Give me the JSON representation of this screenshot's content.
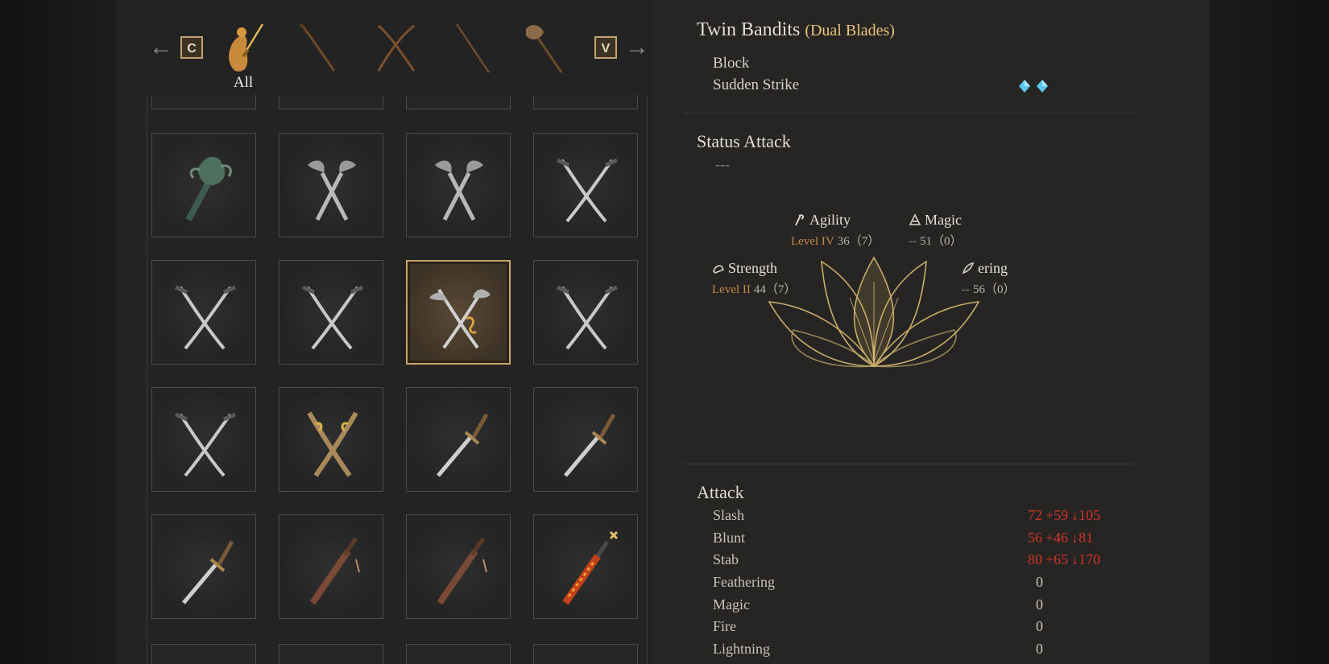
{
  "category_bar": {
    "prev_key": "C",
    "next_key": "V",
    "categories": [
      {
        "icon": "all-weapons-icon",
        "label": "All"
      },
      {
        "icon": "curved-sword-icon"
      },
      {
        "icon": "dual-blades-icon"
      },
      {
        "icon": "spear-icon"
      },
      {
        "icon": "axe-icon"
      }
    ]
  },
  "weapon_grid": {
    "items": [
      {
        "icon": "clawed-club-icon"
      },
      {
        "icon": "hook-dual-blades-icon"
      },
      {
        "icon": "hook-dual-blades-icon"
      },
      {
        "icon": "crossed-sabers-icon"
      },
      {
        "icon": "crossed-sabers-icon"
      },
      {
        "icon": "crossed-sabers-icon"
      },
      {
        "icon": "twin-bandits-icon",
        "selected": true
      },
      {
        "icon": "crossed-sabers-icon"
      },
      {
        "icon": "crossed-sabers-icon"
      },
      {
        "icon": "golden-dual-blades-icon"
      },
      {
        "icon": "straight-sword-icon"
      },
      {
        "icon": "straight-sword-icon"
      },
      {
        "icon": "straight-sword-icon"
      },
      {
        "icon": "sheathed-sword-icon"
      },
      {
        "icon": "sheathed-sword-icon"
      },
      {
        "icon": "flame-sword-icon"
      }
    ]
  },
  "detail": {
    "name": "Twin Bandits",
    "type": "(Dual Blades)",
    "skills": [
      {
        "name": "Block"
      },
      {
        "name": "Sudden Strike",
        "cost_icon": "spirit-diamond-icon",
        "cost": 2
      }
    ],
    "status_attack": {
      "heading": "Status Attack",
      "value": "---"
    },
    "scaling": {
      "agility": {
        "name": "Agility",
        "level": "Level IV",
        "value": "36（7）"
      },
      "magic": {
        "name": "Magic",
        "level": "--",
        "value": "51（0）"
      },
      "strength": {
        "name": "Strength",
        "level": "Level II",
        "value": "44（7）"
      },
      "feathering": {
        "name": "ering",
        "level": "--",
        "value": "56（0）"
      }
    },
    "attack": {
      "heading": "Attack",
      "rows": [
        {
          "name": "Slash",
          "base": "72",
          "bonus": "+59",
          "compare": "↓105"
        },
        {
          "name": "Blunt",
          "base": "56",
          "bonus": "+46",
          "compare": "↓81"
        },
        {
          "name": "Stab",
          "base": "80",
          "bonus": "+65",
          "compare": "↓170"
        },
        {
          "name": "Feathering",
          "base": "0"
        },
        {
          "name": "Magic",
          "base": "0"
        },
        {
          "name": "Fire",
          "base": "0"
        },
        {
          "name": "Lightning",
          "base": "0"
        }
      ]
    }
  },
  "colors": {
    "accent_gold": "#e8c37a",
    "debuff_red": "#d0332a",
    "diamond_blue": "#5cc6ee"
  }
}
